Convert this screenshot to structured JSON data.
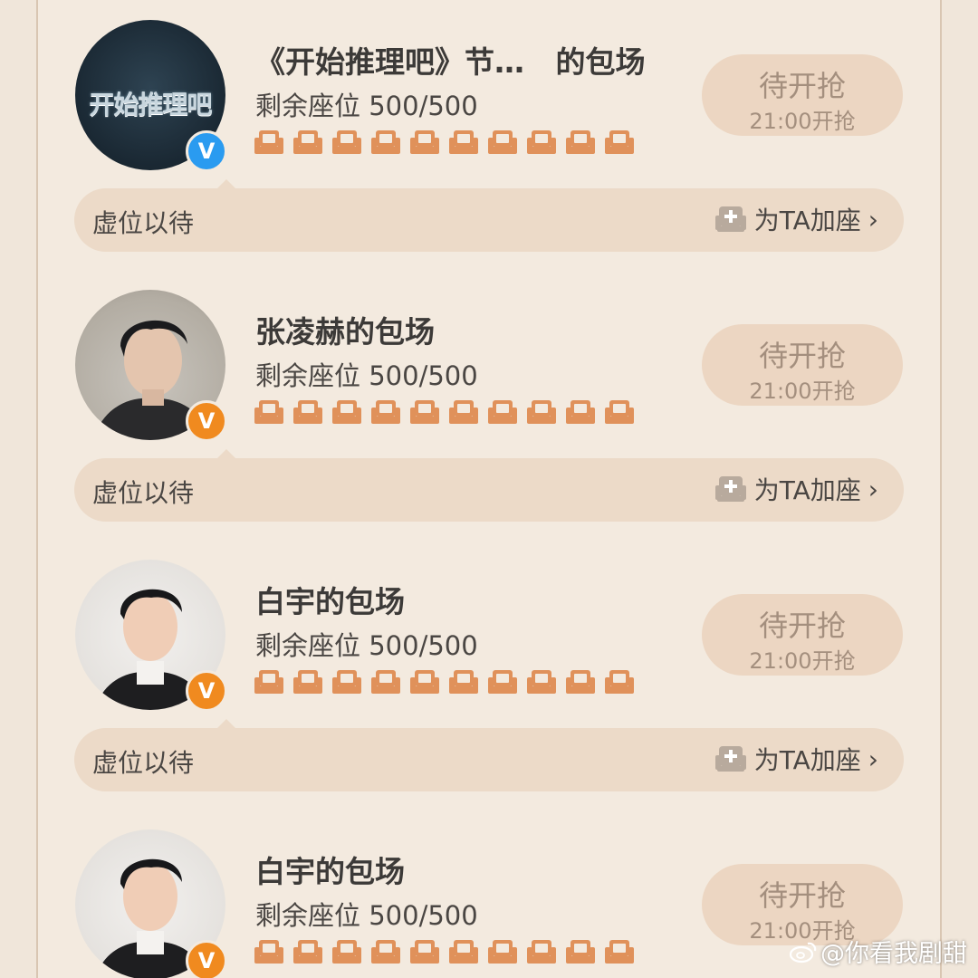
{
  "colors": {
    "page_bg": "#f0e6da",
    "seat_orange": "#e0915a",
    "button_bg": "#ecd6c2",
    "button_text": "#a48f7e",
    "bar_bg": "#ecdac8",
    "verified_blue": "#2a9bf0",
    "verified_orange": "#f08a1f"
  },
  "cards": [
    {
      "title": "《开始推理吧》节…   的包场",
      "avatar_logo_text": "开始推理吧",
      "badge": "V",
      "seats_label": "剩余座位 500/500",
      "seat_count": 10,
      "action_main": "待开抢",
      "action_sub": "21:00开抢",
      "bar_label": "虚位以待",
      "add_seat_label": "为TA加座"
    },
    {
      "title": "张凌赫的包场",
      "badge": "V",
      "seats_label": "剩余座位 500/500",
      "seat_count": 10,
      "action_main": "待开抢",
      "action_sub": "21:00开抢",
      "bar_label": "虚位以待",
      "add_seat_label": "为TA加座"
    },
    {
      "title": "白宇的包场",
      "badge": "V",
      "seats_label": "剩余座位 500/500",
      "seat_count": 10,
      "action_main": "待开抢",
      "action_sub": "21:00开抢",
      "bar_label": "虚位以待",
      "add_seat_label": "为TA加座"
    },
    {
      "title": "白宇的包场",
      "badge": "V",
      "seats_label": "剩余座位 500/500",
      "seat_count": 10,
      "action_main": "待开抢",
      "action_sub": "21:00开抢"
    }
  ],
  "watermark": {
    "text": "@你看我剧甜",
    "icon": "weibo-icon"
  }
}
